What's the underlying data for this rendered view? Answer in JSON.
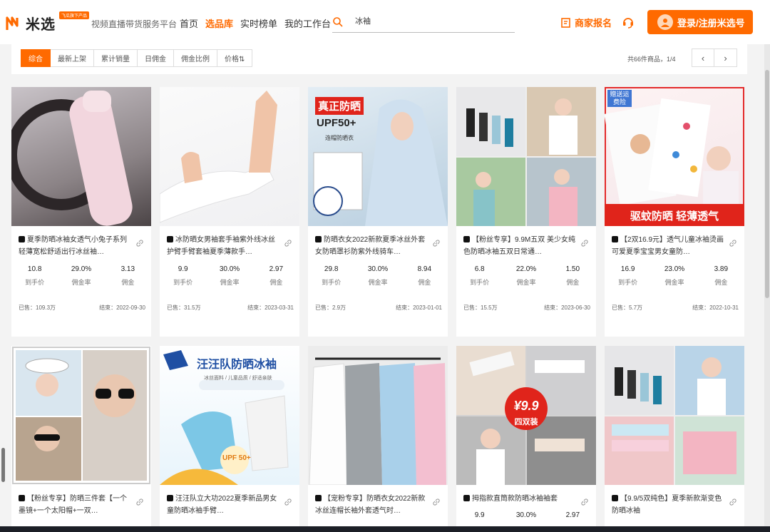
{
  "header": {
    "logo_text": "米选",
    "logo_badge": "飞瓜旗下产品",
    "slogan": "视频直播带货服务平台",
    "nav": [
      {
        "label": "首页",
        "active": false
      },
      {
        "label": "选品库",
        "active": true
      },
      {
        "label": "实时榜单",
        "active": false
      },
      {
        "label": "我的工作台",
        "active": false
      }
    ],
    "search": {
      "value": "冰袖"
    },
    "merchant_label": "商家报名",
    "login_label": "登录/注册米选号",
    "accent_color": "#ff6a00"
  },
  "filter": {
    "tabs": [
      "综合",
      "最新上架",
      "累计销量",
      "日佣金",
      "佣金比例",
      "价格⇅"
    ],
    "active_index": 0,
    "count_text": "共66件商品，1/4",
    "prev": "‹",
    "next": "›"
  },
  "stat_labels": [
    "到手价",
    "佣金率",
    "佣金"
  ],
  "products": [
    {
      "title": "夏季防晒冰袖女透气小兔子系列轻薄宽松舒适出行冰丝袖…",
      "price": "10.8",
      "rate": "29.0%",
      "commission": "3.13",
      "sold": "已售：109.3万",
      "end": "结束：2022-09-30",
      "image": "arm-sleeve-car"
    },
    {
      "title": "冰防晒女男袖套手袖紫外线冰丝护臂手臂套袖夏季薄款手…",
      "price": "9.9",
      "rate": "30.0%",
      "commission": "2.97",
      "sold": "已售：31.5万",
      "end": "结束：2023-03-31",
      "image": "white-sleeve"
    },
    {
      "title": "防晒衣女2022新款夏季冰丝外套女防晒罩衫防紫外线骑车…",
      "price": "29.8",
      "rate": "30.0%",
      "commission": "8.94",
      "sold": "已售：2.9万",
      "end": "结束：2023-01-01",
      "image": "sun-hoodie",
      "banner": "真正防晒",
      "upf": "UPF50+",
      "sub": "连帽防晒衣"
    },
    {
      "title": "【粉丝专享】9.9M五双 美少女纯色防晒冰袖五双日常通…",
      "price": "6.8",
      "rate": "22.0%",
      "commission": "1.50",
      "sold": "已售：15.5万",
      "end": "结束：2023-06-30",
      "image": "five-pairs-collage"
    },
    {
      "title": "【2双16.9元】透气儿童冰袖烫画可爱夏季宝宝男女童防…",
      "price": "16.9",
      "rate": "23.0%",
      "commission": "3.89",
      "sold": "已售：5.7万",
      "end": "结束：2022-10-31",
      "image": "kids-sleeves",
      "corner": "赠送运费险",
      "banner": "驱蚊防晒 轻薄透气"
    },
    {
      "title": "【粉丝专享】防晒三件套【一个墨镜+一个太阳帽+一双…",
      "image": "three-piece-collage"
    },
    {
      "title": "汪汪队立大功2022夏季新品男女童防晒冰袖手臂…",
      "image": "paw-patrol",
      "banner": "汪汪队防晒冰袖",
      "sub": "冰丝面料 / 儿童品质 / 舒适亲肤",
      "badge": "UPF 50+"
    },
    {
      "title": "【宠粉专享】防晒衣女2022新款冰丝连帽长袖外套透气时…",
      "image": "hoodie-rack"
    },
    {
      "title": "拇指款直筒款防晒冰袖袖套",
      "price": "9.9",
      "rate": "30.0%",
      "commission": "2.97",
      "image": "four-pairs",
      "badge_price": "¥9.9",
      "badge_text": "四双装"
    },
    {
      "title": "【9.9/5双纯色】夏季新款渐变色防晒冰袖",
      "image": "gradient-collage"
    }
  ]
}
